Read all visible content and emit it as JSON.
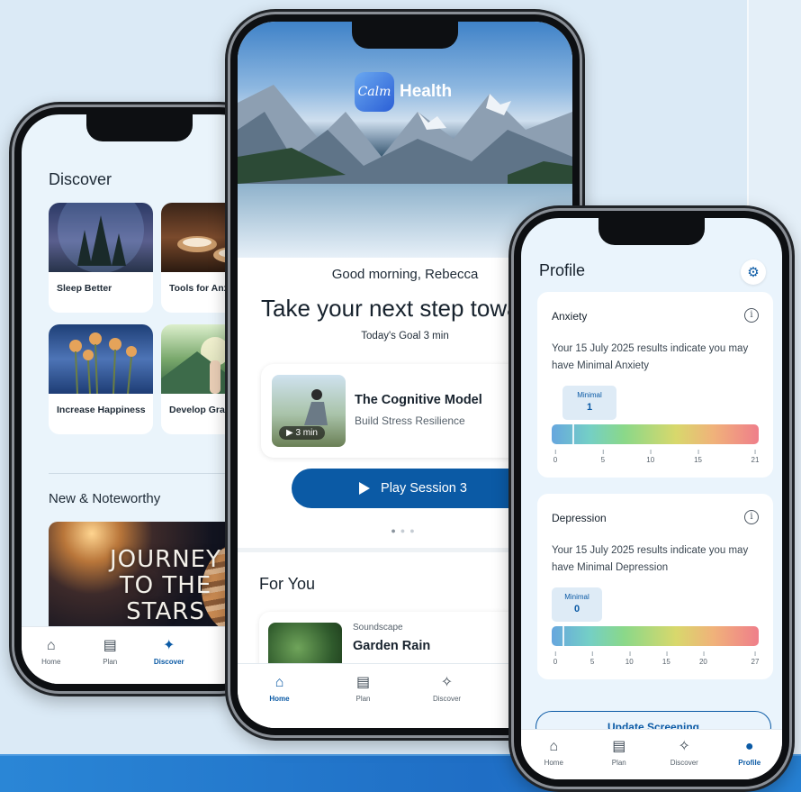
{
  "left_phone": {
    "title": "Discover",
    "tiles": [
      {
        "label": "Sleep Better"
      },
      {
        "label": "Tools for Anxiety"
      },
      {
        "label": "Increase Happiness"
      },
      {
        "label": "Develop Gratitude"
      }
    ],
    "section_title": "New & Noteworthy",
    "feature_title": [
      "JOURNEY",
      "TO THE",
      "STARS"
    ],
    "nav": [
      {
        "label": "Home",
        "icon": "home-icon"
      },
      {
        "label": "Plan",
        "icon": "plan-icon"
      },
      {
        "label": "Discover",
        "icon": "sparkle-icon",
        "active": true
      }
    ]
  },
  "middle_phone": {
    "logo_mark": "Calm",
    "logo_text": "Health",
    "greeting": "Good morning, Rebecca",
    "headline": "Take your next step toward",
    "goal": "Today's Goal 3 min",
    "session": {
      "title": "The Cognitive Model",
      "subtitle": "Build Stress Resilience",
      "duration": "3 min"
    },
    "play_button": "Play Session 3",
    "for_you_title": "For You",
    "for_you_item": {
      "category": "Soundscape",
      "title": "Garden Rain"
    },
    "nav": [
      {
        "label": "Home",
        "icon": "home-icon",
        "active": true
      },
      {
        "label": "Plan",
        "icon": "plan-icon"
      },
      {
        "label": "Discover",
        "icon": "sparkle-icon"
      }
    ]
  },
  "right_phone": {
    "title": "Profile",
    "cards": [
      {
        "title": "Anxiety",
        "description": "Your 15 July 2025 results indicate you may have Minimal Anxiety",
        "badge_label": "Minimal",
        "score": 1,
        "max": 21,
        "ticks": [
          "0",
          "5",
          "10",
          "15",
          "21"
        ]
      },
      {
        "title": "Depression",
        "description": "Your 15 July 2025 results indicate you may have Minimal Depression",
        "badge_label": "Minimal",
        "score": 0,
        "max": 27,
        "ticks": [
          "0",
          "5",
          "10",
          "15",
          "20",
          "27"
        ]
      }
    ],
    "update_button": "Update Screening",
    "nav": [
      {
        "label": "Home",
        "icon": "home-icon"
      },
      {
        "label": "Plan",
        "icon": "plan-icon"
      },
      {
        "label": "Discover",
        "icon": "sparkle-icon"
      },
      {
        "label": "Profile",
        "icon": "profile-icon",
        "active": true
      }
    ]
  },
  "colors": {
    "primary": "#0b5aa5",
    "background": "#dbeaf6",
    "screen_bg": "#eaf4fc"
  }
}
